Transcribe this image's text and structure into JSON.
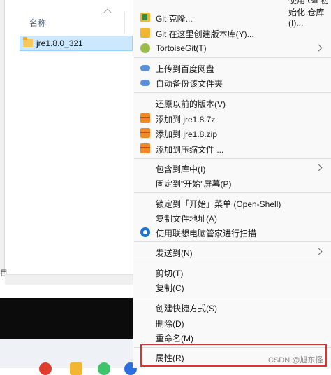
{
  "explorer": {
    "column_header": "名称",
    "file_name": "jre1.8.0_321",
    "left_glyph": "目"
  },
  "menu": {
    "top_partial": "使用 Git 初始化 仓库(I)...",
    "items": [
      {
        "label": "Git 克隆...",
        "icon": "git-clone-icon"
      },
      {
        "label": "Git 在这里创建版本库(Y)...",
        "icon": "git-create-repo-icon"
      },
      {
        "label": "TortoiseGit(T)",
        "icon": "tortoisegit-icon",
        "submenu": true
      },
      {
        "label": "上传到百度网盘",
        "icon": "baidu-cloud-icon"
      },
      {
        "label": "自动备份该文件夹",
        "icon": "baidu-backup-icon"
      },
      {
        "label": "还原以前的版本(V)"
      },
      {
        "label": "添加到 jre1.8.7z",
        "icon": "winrar-icon"
      },
      {
        "label": "添加到 jre1.8.zip",
        "icon": "winrar-icon"
      },
      {
        "label": "添加到压缩文件 ...",
        "icon": "winrar-icon"
      },
      {
        "label": "包含到库中(I)",
        "submenu": true
      },
      {
        "label": "固定到\"开始\"屏幕(P)"
      },
      {
        "label": "锁定到「开始」菜单 (Open-Shell)"
      },
      {
        "label": "复制文件地址(A)"
      },
      {
        "label": "使用联想电脑管家进行扫描",
        "icon": "lenovo-icon"
      },
      {
        "label": "发送到(N)",
        "submenu": true
      },
      {
        "label": "剪切(T)"
      },
      {
        "label": "复制(C)"
      },
      {
        "label": "创建快捷方式(S)"
      },
      {
        "label": "删除(D)"
      },
      {
        "label": "重命名(M)"
      },
      {
        "label": "属性(R)"
      }
    ]
  },
  "watermark": "CSDN @旭东怪",
  "colors": {
    "selection": "#cce8ff",
    "highlight_box": "#e0322e",
    "menu_background": "#f9f9f9"
  }
}
